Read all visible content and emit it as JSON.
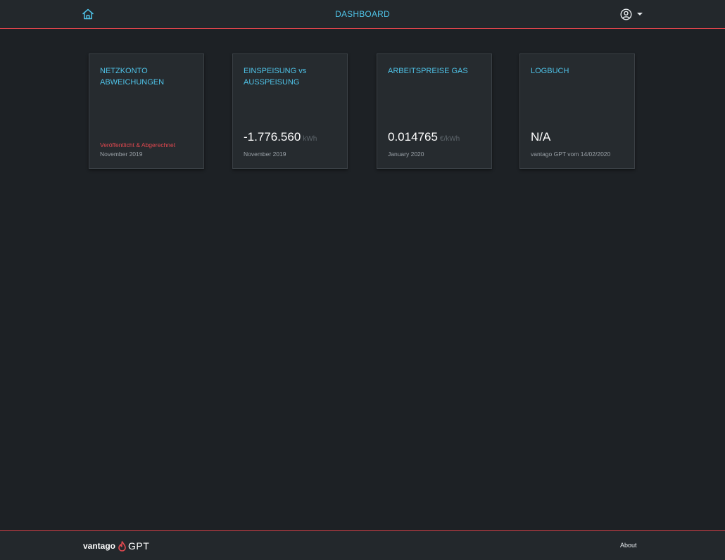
{
  "header": {
    "title": "DASHBOARD",
    "home_icon": "home-icon",
    "user_icon": "user-circle-icon",
    "menu_icon": "caret-down-icon"
  },
  "cards": [
    {
      "title": "NETZKONTO ABWEICHUNGEN",
      "value": "",
      "unit": "",
      "status": "Veröffentlicht & Abgerechnet",
      "subtitle": "November 2019"
    },
    {
      "title": "EINSPEISUNG vs AUSSPEISUNG",
      "value": "-1.776.560",
      "unit": "kWh",
      "status": "",
      "subtitle": "November 2019"
    },
    {
      "title": "ARBEITSPREISE GAS",
      "value": "0.014765",
      "unit": "€/kWh",
      "status": "",
      "subtitle": "January 2020"
    },
    {
      "title": "LOGBUCH",
      "value": "N/A",
      "unit": "",
      "status": "",
      "subtitle": "vantago GPT vom 14/02/2020"
    }
  ],
  "footer": {
    "brand_name": "vantago",
    "brand_product": "GPT",
    "brand_icon": "flame-icon",
    "about_label": "About"
  },
  "colors": {
    "background": "#1d2125",
    "bar": "#23282c",
    "accent": "#4fc3e8",
    "brand_red": "#d9434a",
    "status_red": "#e0484f"
  }
}
